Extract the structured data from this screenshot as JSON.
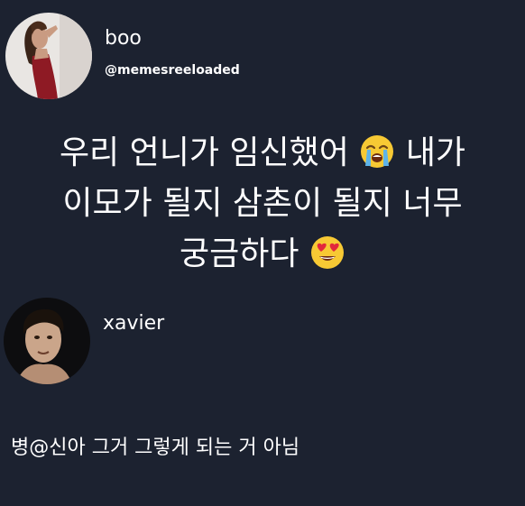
{
  "post": {
    "username": "boo",
    "handle": "@memesreeloaded",
    "text_line1": "우리 언니가 임신했어",
    "emoji1": "loudly-crying-face",
    "text_line1b": "내가",
    "text_line2": "이모가 될지 삼촌이 될지 너무",
    "text_line3": "궁금하다",
    "emoji2": "smiling-face-with-heart-eyes"
  },
  "reply": {
    "username": "xavier",
    "text": "병@신아 그거 그렇게 되는 거 아님"
  },
  "colors": {
    "background": "#1c2230",
    "text": "#ffffff"
  }
}
